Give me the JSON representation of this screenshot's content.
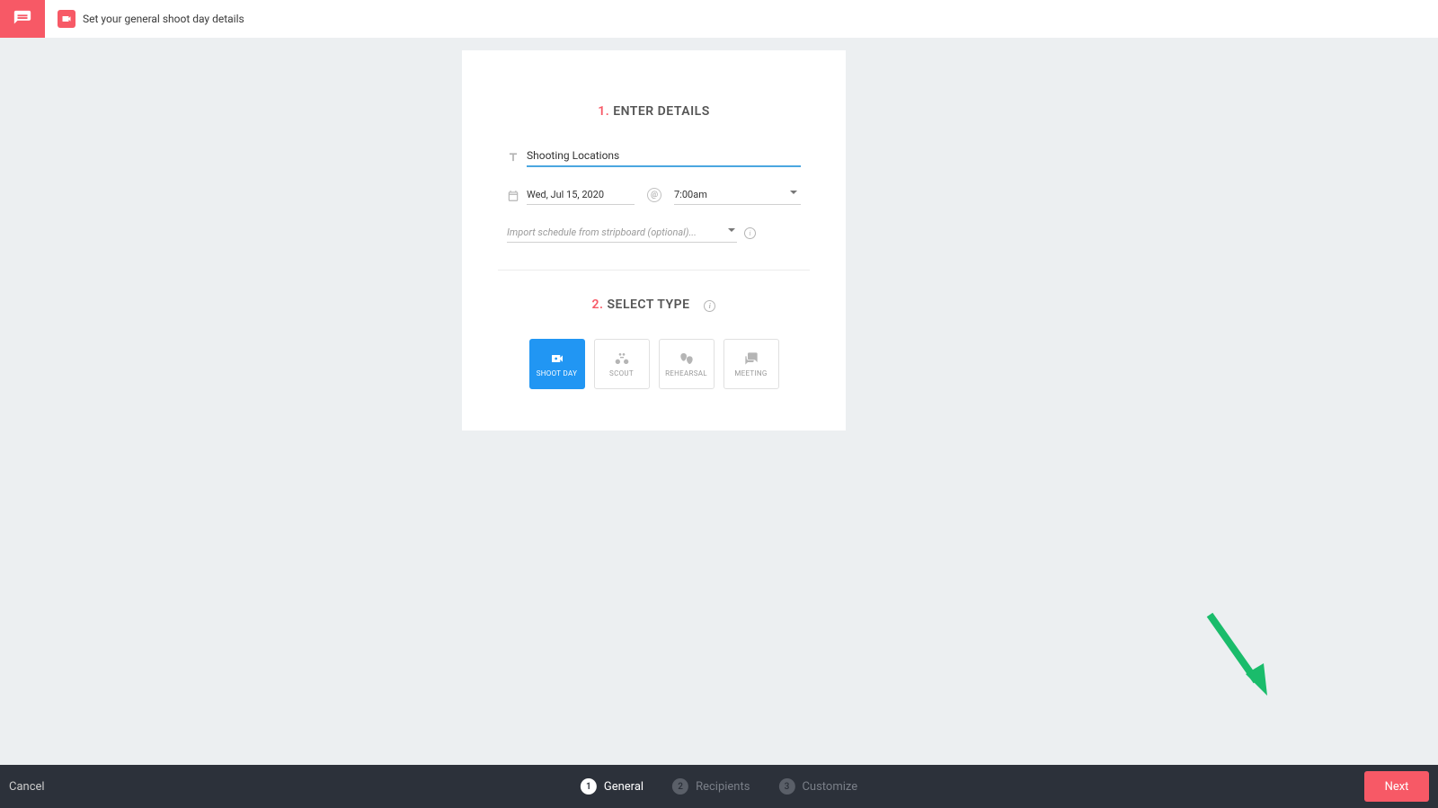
{
  "header": {
    "title": "Set your general shoot day details"
  },
  "section1": {
    "num": "1.",
    "label": "ENTER DETAILS",
    "titleValue": "Shooting Locations",
    "dateValue": "Wed, Jul 15, 2020",
    "timeValue": "7:00am",
    "importPlaceholder": "Import schedule from stripboard (optional)..."
  },
  "section2": {
    "num": "2.",
    "label": "SELECT TYPE",
    "types": [
      {
        "label": "SHOOT DAY"
      },
      {
        "label": "SCOUT"
      },
      {
        "label": "REHEARSAL"
      },
      {
        "label": "MEETING"
      }
    ]
  },
  "footer": {
    "cancel": "Cancel",
    "next": "Next",
    "steps": [
      {
        "num": "1",
        "label": "General"
      },
      {
        "num": "2",
        "label": "Recipients"
      },
      {
        "num": "3",
        "label": "Customize"
      }
    ]
  }
}
